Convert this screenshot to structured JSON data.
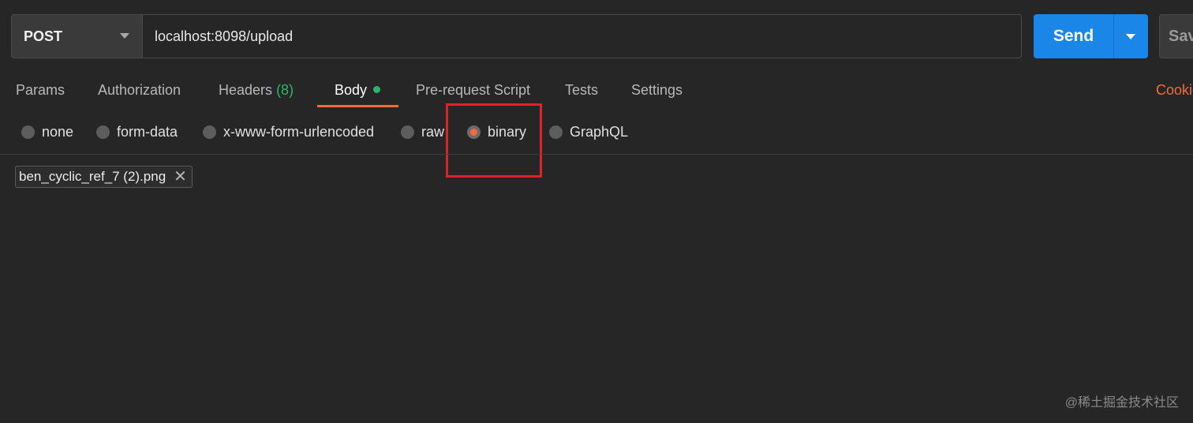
{
  "request": {
    "method": "POST",
    "url": "localhost:8098/upload",
    "send_label": "Send",
    "save_label": "Sav"
  },
  "tabs": [
    {
      "label": "Params"
    },
    {
      "label": "Authorization"
    },
    {
      "label": "Headers",
      "count": "(8)"
    },
    {
      "label": "Body",
      "active": true
    },
    {
      "label": "Pre-request Script"
    },
    {
      "label": "Tests"
    },
    {
      "label": "Settings"
    }
  ],
  "cookies_label": "Cookie",
  "body_types": [
    {
      "label": "none"
    },
    {
      "label": "form-data"
    },
    {
      "label": "x-www-form-urlencoded"
    },
    {
      "label": "raw"
    },
    {
      "label": "binary",
      "selected": true
    },
    {
      "label": "GraphQL"
    }
  ],
  "file": {
    "name": "ben_cyclic_ref_7 (2).png"
  },
  "watermark": "@稀土掘金技术社区",
  "colors": {
    "accent_orange": "#f26b3a",
    "send_blue": "#1a86e8",
    "indicator_green": "#2fb36b",
    "highlight_red": "#e0202a"
  }
}
